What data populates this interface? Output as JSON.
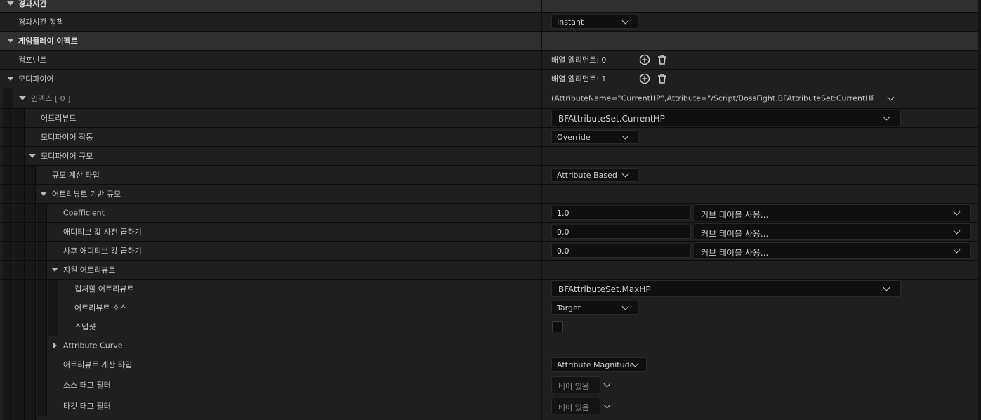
{
  "sections": {
    "duration": {
      "header": "경과시간",
      "policy_label": "경과시간 정책",
      "policy_value": "Instant"
    },
    "gameplay_effect": {
      "header": "게임플레이 이펙트",
      "components_label": "컴포넌트",
      "components_value": "배열 엘리먼트: 0",
      "modifiers_label": "모디파이어",
      "modifiers_value": "배열 엘리먼트: 1"
    }
  },
  "modifier": {
    "index_label": "인덱스 [ 0 ]",
    "index_summary": "(AttributeName=\"CurrentHP\",Attribute=\"/Script/BossFight.BFAttributeSet:CurrentHP\",Attribu",
    "attribute_label": "어트리뷰트",
    "attribute_value": "BFAttributeSet.CurrentHP",
    "op_label": "모디파이어 작동",
    "op_value": "Override",
    "magnitude_label": "모디파이어 규모",
    "calc_type_label": "규모 계산 타입",
    "calc_type_value": "Attribute Based",
    "attr_based_label": "어트리뷰트 기반 규모",
    "coefficient_label": "Coefficient",
    "coefficient_value": "1.0",
    "pre_add_label": "애디티브 값 사전 곱하기",
    "pre_add_value": "0.0",
    "post_add_label": "사후 애디티브 값 곱하기",
    "post_add_value": "0.0",
    "curve_placeholder": "커브 테이블 사용...",
    "backing_label": "지원 어트리뷰트",
    "capture_label": "캡처할 어트리뷰트",
    "capture_value": "BFAttributeSet.MaxHP",
    "source_label": "어트리뷰트 소스",
    "source_value": "Target",
    "snapshot_label": "스냅샷",
    "attr_curve_label": "Attribute Curve",
    "attr_calc_type_label": "어트리뷰트 계산 타입",
    "attr_calc_type_value": "Attribute Magnitude",
    "source_tag_label": "소스 태그 필터",
    "target_tag_label": "타깃 태그 필터",
    "empty_tag": "비어 있음"
  },
  "icons": {
    "add": "plus-circle-icon",
    "delete": "trash-icon",
    "expand": "chevron-down-icon"
  }
}
